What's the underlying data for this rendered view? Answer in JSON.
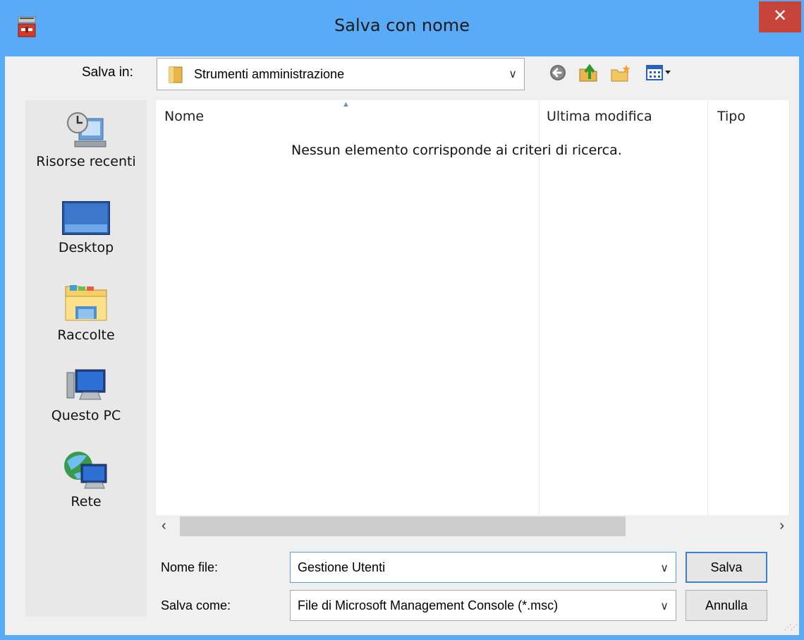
{
  "window": {
    "title": "Salva con nome"
  },
  "toolbar": {
    "save_in_label": "Salva in:",
    "save_in_value": "Strumenti amministrazione",
    "icons": [
      "back-icon",
      "up-folder-icon",
      "new-folder-icon",
      "view-menu-icon"
    ]
  },
  "places": [
    {
      "label": "Risorse recenti",
      "icon": "recent-places-icon"
    },
    {
      "label": "Desktop",
      "icon": "desktop-icon"
    },
    {
      "label": "Raccolte",
      "icon": "libraries-icon"
    },
    {
      "label": "Questo PC",
      "icon": "this-pc-icon"
    },
    {
      "label": "Rete",
      "icon": "network-icon"
    }
  ],
  "list": {
    "columns": [
      "Nome",
      "Ultima modifica",
      "Tipo"
    ],
    "empty_message": "Nessun elemento corrisponde ai criteri di ricerca."
  },
  "footer": {
    "filename_label": "Nome file:",
    "filename_value": "Gestione Utenti",
    "filetype_label": "Salva come:",
    "filetype_value": "File di Microsoft Management Console (*.msc)",
    "save_button": "Salva",
    "cancel_button": "Annulla"
  },
  "colors": {
    "titlebar": "#5aabf7",
    "close": "#c7443a",
    "dialog_bg": "#f0f0f0"
  }
}
